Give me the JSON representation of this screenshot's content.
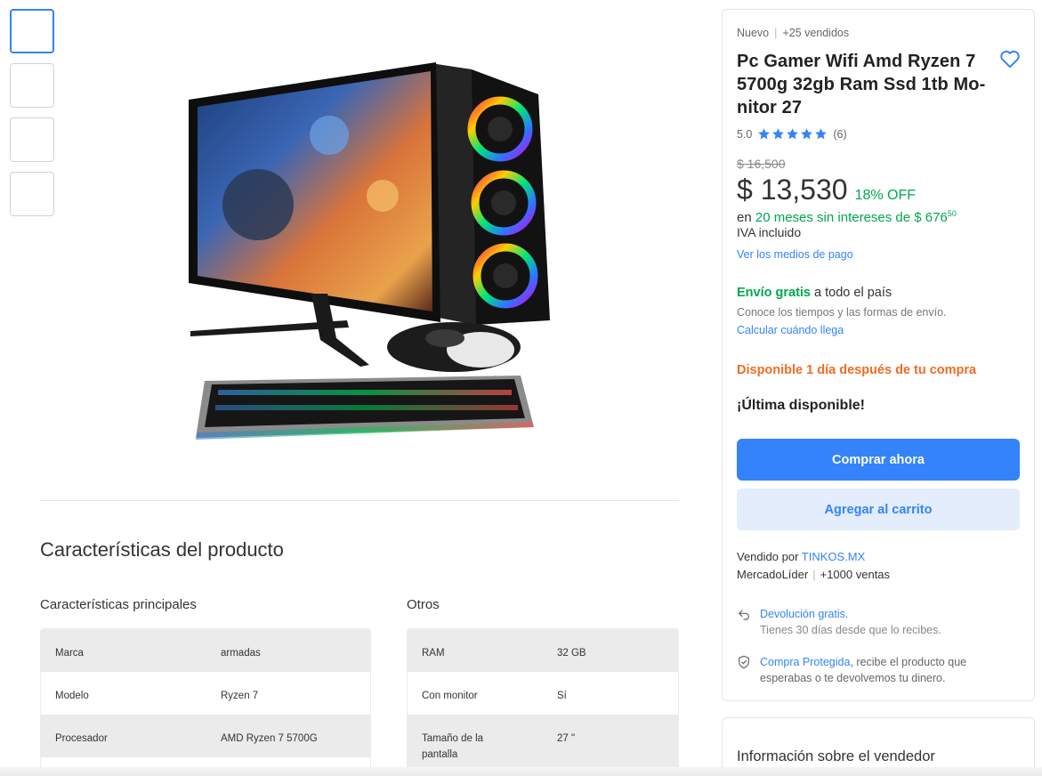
{
  "gallery": {
    "thumbnail_count": 4,
    "image_alt": "Pc Gamer Wifi Amd Ryzen 7 5700g 32gb Ram Ssd 1tb Monitor 27"
  },
  "specs": {
    "section_title": "Características del producto",
    "principal_title": "Características principales",
    "principal": [
      {
        "k": "Marca",
        "v": "armadas"
      },
      {
        "k": "Modelo",
        "v": "Ryzen 7"
      },
      {
        "k": "Procesador",
        "v": "AMD Ryzen 7 5700G"
      }
    ],
    "others_title": "Otros",
    "others": [
      {
        "k": "RAM",
        "v": "32 GB"
      },
      {
        "k": "Con monitor",
        "v": "Sí"
      },
      {
        "k": "Tamaño de la pantalla",
        "v": "27 \""
      }
    ]
  },
  "buybox": {
    "condition": "Nuevo",
    "sold": "+25 vendidos",
    "title": "Pc Gamer Wifi Amd Ryzen 7 5700g 32gb Ram Ssd 1tb Mo- nitor 27",
    "rating": "5.0",
    "stars": 5,
    "reviews": "(6)",
    "old_price": "$ 16,500",
    "price": "$ 13,530",
    "discount": "18% OFF",
    "installments_prefix": "en",
    "installments_text": "20 meses sin intereses de $ 676",
    "installments_cents": "50",
    "iva": "IVA incluido",
    "payment_link": "Ver los medios de pago",
    "shipping_free": "Envío gratis",
    "shipping_rest": "a todo el país",
    "shipping_sub": "Conoce los tiempos y las formas de envío.",
    "shipping_link": "Calcular cuándo llega",
    "availability": "Disponible 1 día después de tu compra",
    "stock": "¡Última disponible!",
    "buy_label": "Comprar ahora",
    "cart_label": "Agregar al carrito",
    "sold_by": "Vendido por",
    "seller_name": "TINKOS.MX",
    "seller_badge": "MercadoLíder",
    "seller_sales": "+1000 ventas",
    "return_link": "Devolución gratis.",
    "return_sub": "Tienes 30 días desde que lo recibes.",
    "protect_link": "Compra Protegida",
    "protect_rest": ", recibe el producto que esperabas o te devolvemos tu dinero."
  },
  "seller_info": {
    "title": "Información sobre el vendedor"
  },
  "colors": {
    "accent": "#3483fa",
    "green": "#00a650",
    "orange": "#f06c23"
  }
}
